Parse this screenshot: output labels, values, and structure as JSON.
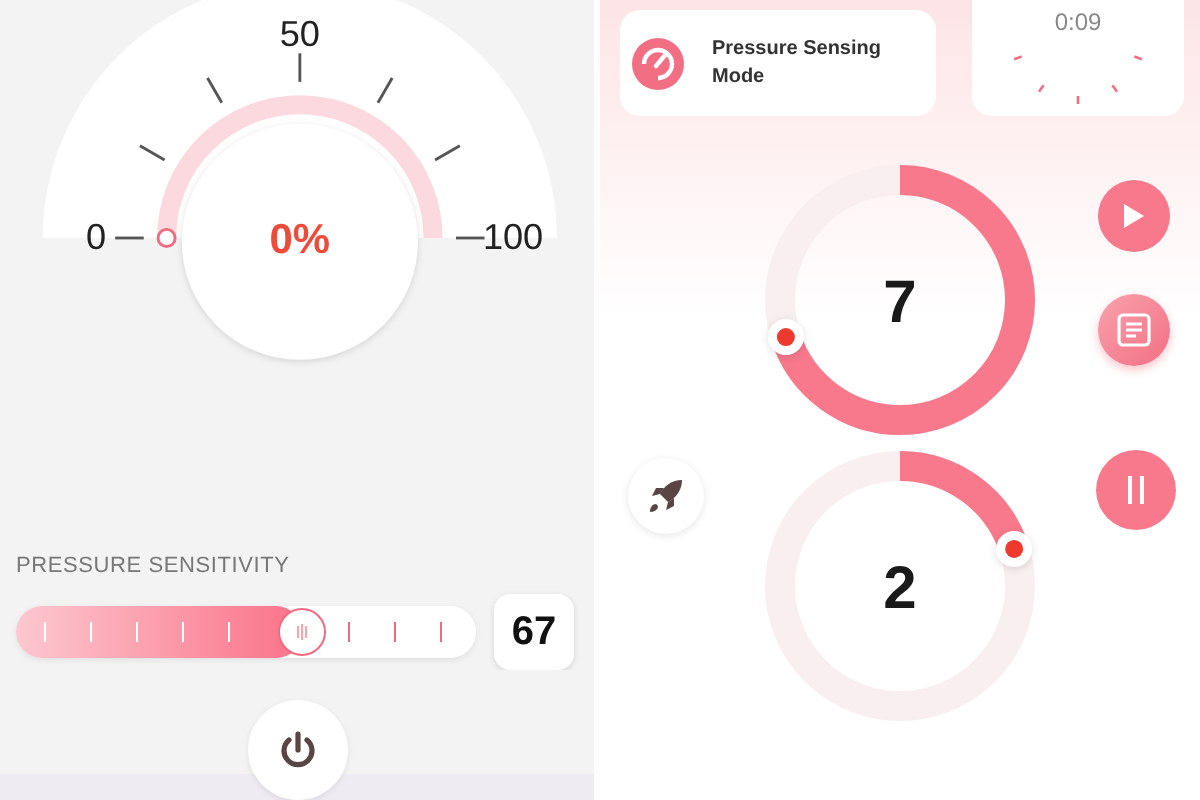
{
  "gauge": {
    "ticks": [
      "0",
      "50",
      "100"
    ],
    "value": "0%"
  },
  "sensitivity": {
    "label": "PRESSURE SENSITIVITY",
    "level": 0.62,
    "reading": "67"
  },
  "mode_card": {
    "label": "Pressure Sensing Mode"
  },
  "timer": {
    "time": "0:09"
  },
  "dials": [
    {
      "value": "7"
    },
    {
      "value": "2"
    }
  ]
}
